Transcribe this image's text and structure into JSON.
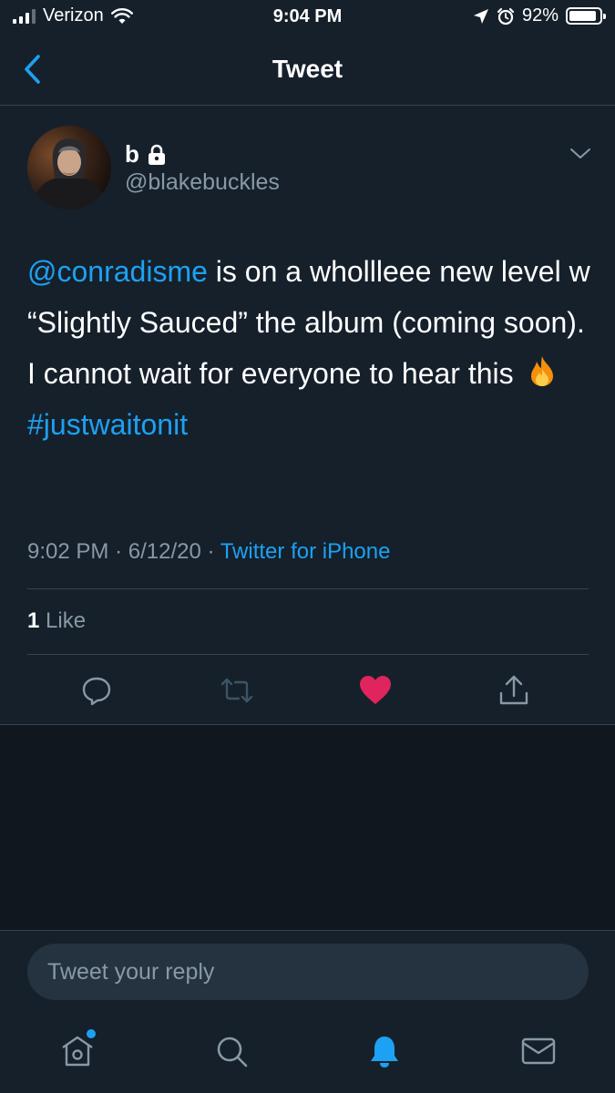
{
  "status_bar": {
    "carrier": "Verizon",
    "time": "9:04 PM",
    "battery_percent": "92%",
    "battery_level": 0.92
  },
  "nav": {
    "title": "Tweet",
    "back_icon": "chevron-left-icon"
  },
  "tweet": {
    "author_name": "b",
    "protected_icon": "lock-icon",
    "handle": "@blakebuckles",
    "mention": "@conradisme",
    "text_part1": " is on a whollleee new level w “Slightly Sauced” the album (coming soon). I cannot wait for everyone to hear this",
    "emoji_icon": "fire-emoji",
    "hashtag": "#justwaitonit",
    "time": "9:02 PM",
    "date": "6/12/20",
    "separator": "·",
    "source": "Twitter for iPhone",
    "like_count": "1",
    "like_label": "Like"
  },
  "actions": {
    "reply_icon": "reply-icon",
    "retweet_icon": "retweet-icon",
    "like_icon": "heart-icon",
    "share_icon": "share-icon"
  },
  "reply": {
    "placeholder": "Tweet your reply"
  },
  "tabs": [
    {
      "name": "home",
      "icon": "home-icon",
      "has_dot": true
    },
    {
      "name": "search",
      "icon": "search-icon"
    },
    {
      "name": "notifications",
      "icon": "bell-icon",
      "active": true
    },
    {
      "name": "messages",
      "icon": "mail-icon"
    }
  ],
  "colors": {
    "background": "#15202b",
    "accent": "#1da1f2",
    "like": "#e0245e",
    "muted": "#8899a6"
  }
}
